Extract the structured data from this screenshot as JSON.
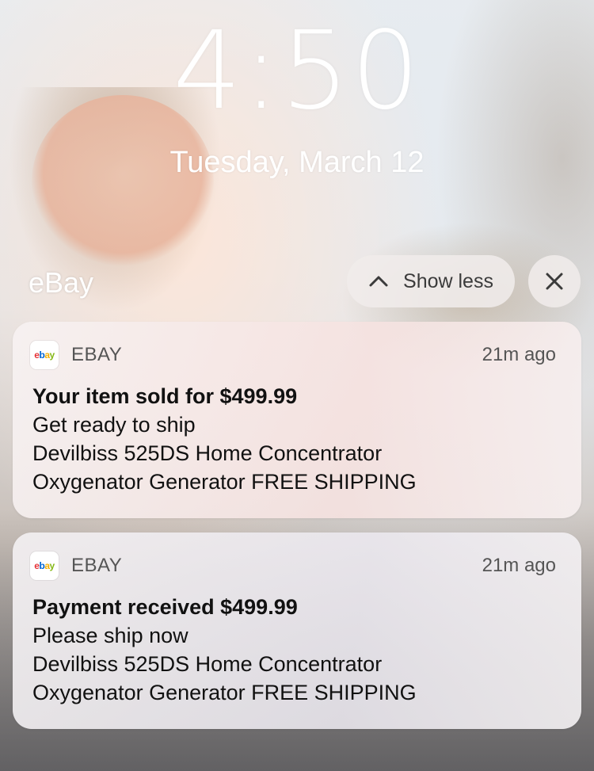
{
  "lockscreen": {
    "time": "4:50",
    "date": "Tuesday, March 12"
  },
  "group": {
    "title": "eBay",
    "show_less_label": "Show less",
    "chevron_icon": "chevron-up-icon",
    "close_icon": "close-icon"
  },
  "notifications": [
    {
      "app_icon": "ebay-logo",
      "app_icon_text": [
        "e",
        "b",
        "a",
        "y"
      ],
      "app_name": "EBAY",
      "time": "21m ago",
      "title": "Your item sold for $499.99",
      "lines": [
        "Get ready to ship",
        "Devilbiss 525DS Home Concentrator",
        "Oxygenator Generator FREE SHIPPING"
      ]
    },
    {
      "app_icon": "ebay-logo",
      "app_icon_text": [
        "e",
        "b",
        "a",
        "y"
      ],
      "app_name": "EBAY",
      "time": "21m ago",
      "title": "Payment received $499.99",
      "lines": [
        "Please ship now",
        "Devilbiss 525DS Home Concentrator",
        "Oxygenator Generator FREE SHIPPING"
      ]
    }
  ],
  "colors": {
    "ebay_red": "#e53238",
    "ebay_blue": "#0064d2",
    "ebay_yellow": "#f5af02",
    "ebay_green": "#86b817"
  }
}
